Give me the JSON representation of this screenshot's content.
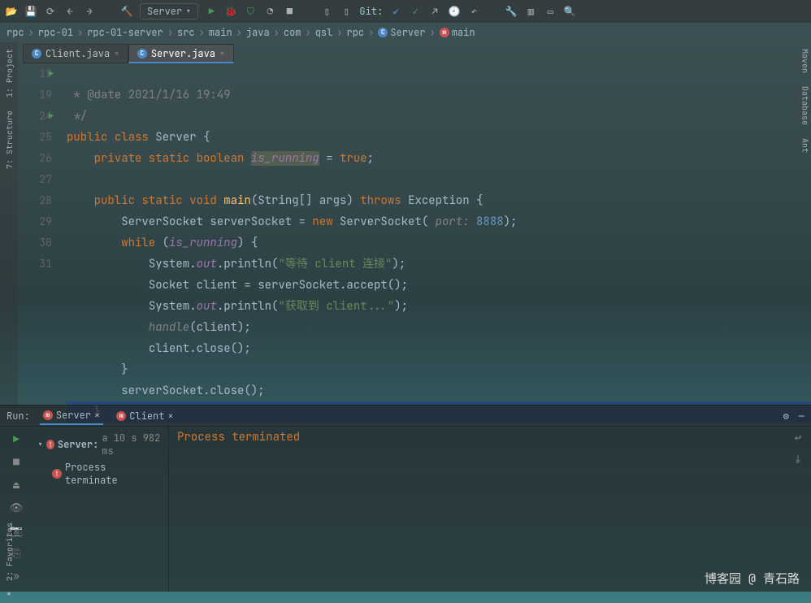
{
  "toolbar": {
    "run_config": "Server",
    "git_label": "Git:"
  },
  "breadcrumb": [
    "rpc",
    "rpc-01",
    "rpc-01-server",
    "src",
    "main",
    "java",
    "com",
    "qsl",
    "rpc",
    "Server",
    "main"
  ],
  "tabs": [
    {
      "name": "Client.java",
      "active": false
    },
    {
      "name": "Server.java",
      "active": true
    }
  ],
  "sidebar_left": [
    "1: Project",
    "7: Structure"
  ],
  "sidebar_right": [
    "Maven",
    "Database",
    "Ant"
  ],
  "gutter": [
    "",
    "",
    "18",
    "19",
    "",
    "",
    "",
    "",
    "",
    "24",
    "25",
    "26",
    "27",
    "28",
    "29",
    "30",
    "31"
  ],
  "code": {
    "l0": " * @date 2021/1/16 19:49",
    "l1": " */",
    "l2_a": "public",
    "l2_b": "class",
    "l2_c": "Server {",
    "l3_a": "private static",
    "l3_b": "boolean",
    "l3_c": "is_running",
    "l3_d": "= ",
    "l3_e": "true",
    "l3_f": ";",
    "l5_a": "public static",
    "l5_b": "void",
    "l5_c": "main",
    "l5_d": "(String[] args)",
    "l5_e": "throws",
    "l5_f": "Exception {",
    "l6_a": "ServerSocket serverSocket = ",
    "l6_b": "new",
    "l6_c": "ServerSocket(",
    "l6_d": "port:",
    "l6_e": "8888",
    "l6_f": ");",
    "l7_a": "while",
    "l7_b": "(",
    "l7_c": "is_running",
    "l7_d": ") {",
    "l8_a": "System.",
    "l8_b": "out",
    "l8_c": ".println(",
    "l8_d": "\"等待 client 连接\"",
    "l8_e": ");",
    "l9": "Socket client = serverSocket.accept();",
    "l10_a": "System.",
    "l10_b": "out",
    "l10_c": ".println(",
    "l10_d": "\"获取到 client...\"",
    "l10_e": ");",
    "l11_a": "handle",
    "l11_b": "(client);",
    "l12": "client.close();",
    "l13": "}",
    "l14": "serverSocket.close();",
    "l15": "}"
  },
  "run": {
    "label": "Run:",
    "tabs": [
      {
        "name": "Server",
        "active": true
      },
      {
        "name": "Client",
        "active": false
      }
    ],
    "tree_root": "Server:",
    "tree_time": "a 10 s 982 ms",
    "tree_child": "Process terminate",
    "console": "Process terminated"
  },
  "favorites": "2: Favorites",
  "watermark": "博客园 @ 青石路"
}
